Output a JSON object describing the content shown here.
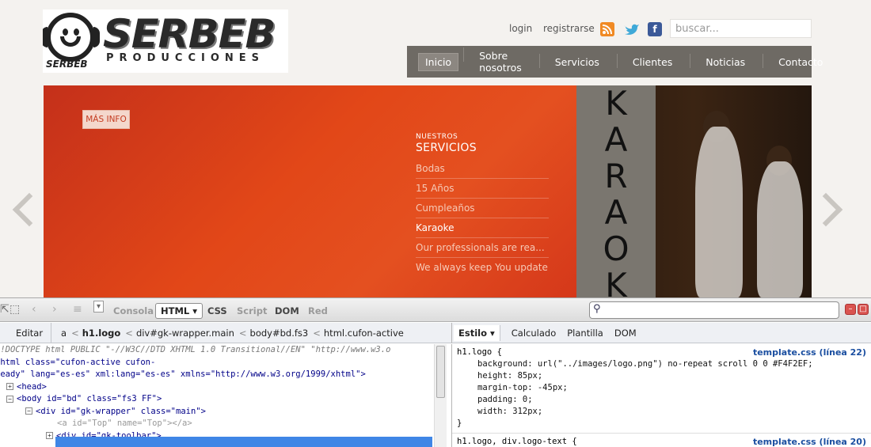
{
  "site": {
    "logo": {
      "brand": "SERBEB",
      "sub": "PRODUCCIONES",
      "mini": "SERBEB"
    },
    "top_links": {
      "login": "login",
      "register": "registrarse"
    },
    "social": {
      "rss": "rss-icon",
      "twitter": "twitter-icon",
      "facebook": "f"
    },
    "search_placeholder": "buscar...",
    "menu": [
      "Inicio",
      "Sobre nosotros",
      "Servicios",
      "Clientes",
      "Noticias",
      "Contacto"
    ],
    "slider": {
      "more_info": "MÁS INFO",
      "heading_small": "NUESTROS",
      "heading_big": "SERVICIOS",
      "services": [
        "Bodas",
        "15 Años",
        "Cumpleaños",
        "Karaoke",
        "Our professionals are rea...",
        "We always keep You update..."
      ],
      "karaoke_letters": [
        "K",
        "A",
        "R",
        "A",
        "O",
        "K"
      ]
    }
  },
  "firebug": {
    "tabs": [
      "Consola",
      "HTML",
      "CSS",
      "Script",
      "DOM",
      "Red"
    ],
    "breadcrumb": {
      "edit": "Editar",
      "items": [
        "a",
        "h1.logo",
        "div#gk-wrapper.main",
        "body#bd.fs3",
        "html.cufon-active"
      ]
    },
    "side_tabs": [
      "Estilo",
      "Calculado",
      "Plantilla",
      "DOM"
    ],
    "html_lines": {
      "doctype": "<!DOCTYPE html PUBLIC \"-//W3C//DTD XHTML 1.0 Transitional//EN\" \"http://www.w3.o",
      "html_open_a": "<html class=\"cufon-active cufon-",
      "html_open_b": "ready\" lang=\"es-es\" xml:lang=\"es-es\" xmlns=\"http://www.w3.org/1999/xhtml\">",
      "head": "<head>",
      "body": "<body id=\"bd\" class=\"fs3 FF\">",
      "wrapper": "<div id=\"gk-wrapper\" class=\"main\">",
      "anchor": "<a id=\"Top\" name=\"Top\"></a>",
      "toolbar": "<div id=\"gk-toolbar\">"
    },
    "css": {
      "rule1_selector": "h1.logo {",
      "rule1_source": "template.css (línea 22)",
      "rule1_props": [
        "background: url(\"../images/logo.png\") no-repeat scroll 0 0 #F4F2EF;",
        "height: 85px;",
        "margin-top: -45px;",
        "padding: 0;",
        "width: 312px;"
      ],
      "rule1_close": "}",
      "rule2_selector": "h1.logo, div.logo-text {",
      "rule2_source": "template.css (línea 20)"
    }
  }
}
